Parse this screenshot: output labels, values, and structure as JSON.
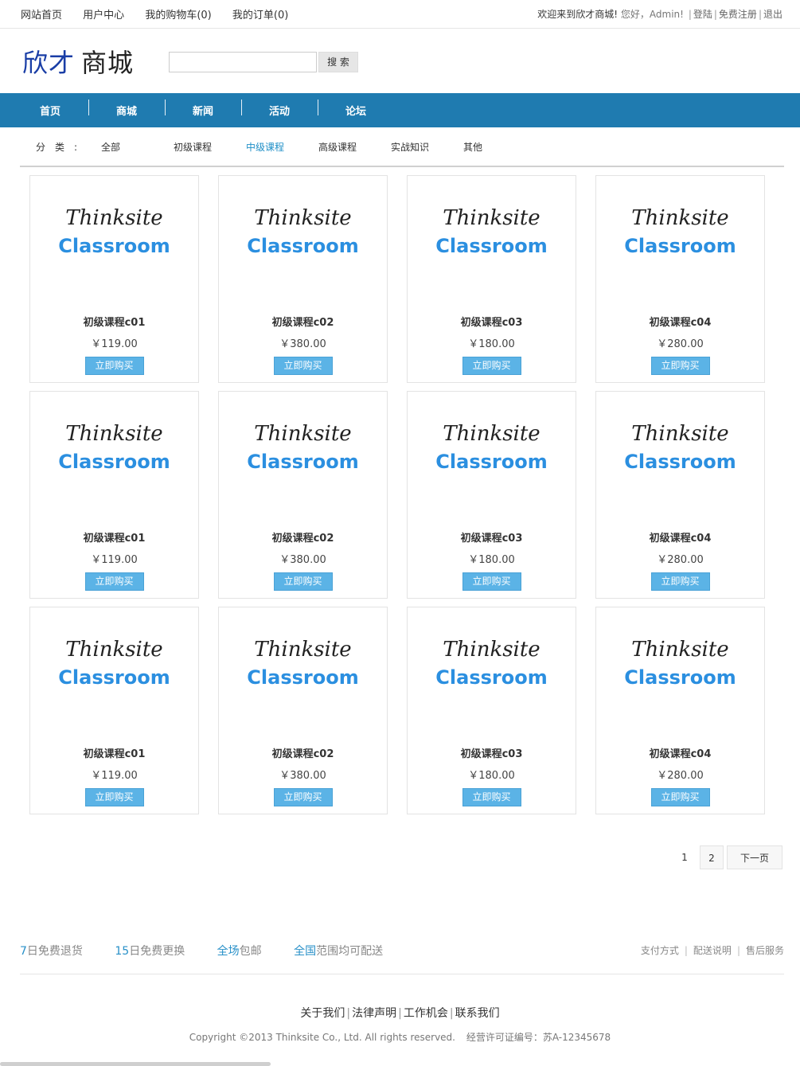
{
  "topbar": {
    "links": [
      "网站首页",
      "用户中心",
      "我的购物车(0)",
      "我的订单(0)"
    ],
    "welcome": "欢迎来到欣才商城!",
    "greeting": "您好，Admin!",
    "sep": "|",
    "login": "登陆",
    "register": "免费注册",
    "logout": "退出"
  },
  "header": {
    "logo_part1": "欣才",
    "logo_part2": "商城",
    "search_button": "搜 索",
    "search_value": ""
  },
  "nav": [
    "首页",
    "商城",
    "新闻",
    "活动",
    "论坛"
  ],
  "categories": {
    "label": "分类:",
    "items": [
      "全部",
      "初级课程",
      "中级课程",
      "高级课程",
      "实战知识",
      "其他"
    ],
    "active": "中级课程"
  },
  "products": [
    {
      "img_line1": "Thinksite",
      "img_line2": "Classroom",
      "name": "初级课程c01",
      "price": "￥119.00",
      "buy": "立即购买"
    },
    {
      "img_line1": "Thinksite",
      "img_line2": "Classroom",
      "name": "初级课程c02",
      "price": "￥380.00",
      "buy": "立即购买"
    },
    {
      "img_line1": "Thinksite",
      "img_line2": "Classroom",
      "name": "初级课程c03",
      "price": "￥180.00",
      "buy": "立即购买"
    },
    {
      "img_line1": "Thinksite",
      "img_line2": "Classroom",
      "name": "初级课程c04",
      "price": "￥280.00",
      "buy": "立即购买"
    },
    {
      "img_line1": "Thinksite",
      "img_line2": "Classroom",
      "name": "初级课程c01",
      "price": "￥119.00",
      "buy": "立即购买"
    },
    {
      "img_line1": "Thinksite",
      "img_line2": "Classroom",
      "name": "初级课程c02",
      "price": "￥380.00",
      "buy": "立即购买"
    },
    {
      "img_line1": "Thinksite",
      "img_line2": "Classroom",
      "name": "初级课程c03",
      "price": "￥180.00",
      "buy": "立即购买"
    },
    {
      "img_line1": "Thinksite",
      "img_line2": "Classroom",
      "name": "初级课程c04",
      "price": "￥280.00",
      "buy": "立即购买"
    },
    {
      "img_line1": "Thinksite",
      "img_line2": "Classroom",
      "name": "初级课程c01",
      "price": "￥119.00",
      "buy": "立即购买"
    },
    {
      "img_line1": "Thinksite",
      "img_line2": "Classroom",
      "name": "初级课程c02",
      "price": "￥380.00",
      "buy": "立即购买"
    },
    {
      "img_line1": "Thinksite",
      "img_line2": "Classroom",
      "name": "初级课程c03",
      "price": "￥180.00",
      "buy": "立即购买"
    },
    {
      "img_line1": "Thinksite",
      "img_line2": "Classroom",
      "name": "初级课程c04",
      "price": "￥280.00",
      "buy": "立即购买"
    }
  ],
  "pager": {
    "pages": [
      "1",
      "2"
    ],
    "current": "1",
    "next": "下一页"
  },
  "service": {
    "promos": [
      {
        "hl": "7",
        "text": "日免费退货"
      },
      {
        "hl": "15",
        "text": "日免费更换"
      },
      {
        "hl": "全场",
        "text": "包邮"
      },
      {
        "hl": "全国",
        "text": "范围均可配送"
      }
    ],
    "links": [
      "支付方式",
      "配送说明",
      "售后服务"
    ],
    "sep": "|"
  },
  "footer": {
    "links": [
      "关于我们",
      "法律声明",
      "工作机会",
      "联系我们"
    ],
    "sep": "|",
    "copyright": "Copyright ©2013 Thinksite Co., Ltd. All rights reserved.",
    "license": "经营许可证编号：苏A-12345678"
  },
  "colors": {
    "nav_bg": "#1f7bb0",
    "accent": "#1f8fc7",
    "buy_button": "#5bb3e6",
    "logo_blue": "#1a3ea6",
    "classroom_blue": "#2b8fe0"
  }
}
